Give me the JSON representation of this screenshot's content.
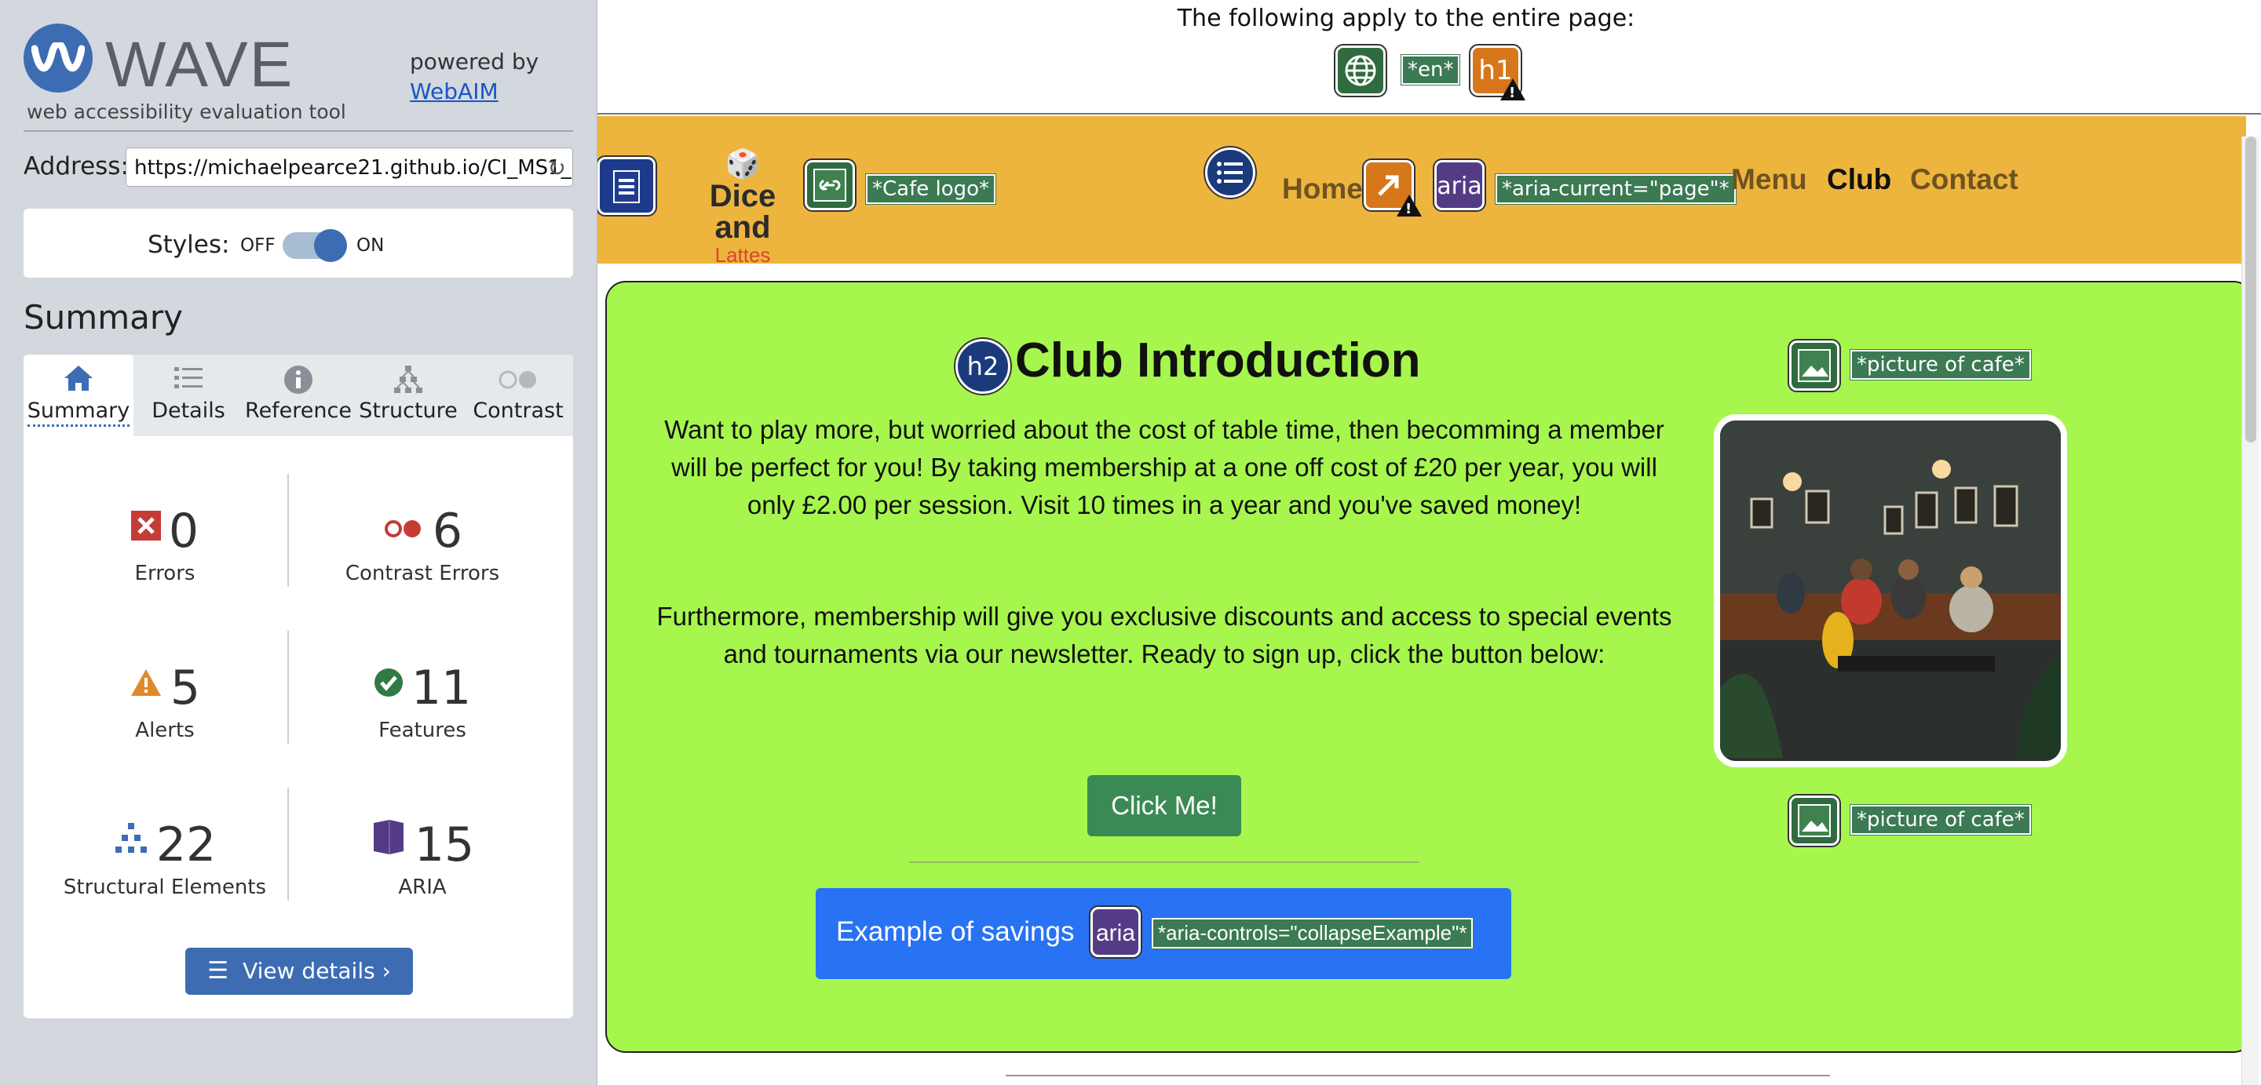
{
  "sidebar": {
    "logo_text": "WAVE",
    "tagline": "web accessibility evaluation tool",
    "powered_by": "powered by",
    "webaim_link": "WebAIM",
    "address_label": "Address:",
    "address_value": "https://michaelpearce21.github.io/CI_MS1_",
    "styles_label": "Styles:",
    "styles_off": "OFF",
    "styles_on": "ON",
    "summary_heading": "Summary",
    "tabs": [
      {
        "label": "Summary",
        "icon": "home-icon"
      },
      {
        "label": "Details",
        "icon": "list-icon"
      },
      {
        "label": "Reference",
        "icon": "info-icon"
      },
      {
        "label": "Structure",
        "icon": "hierarchy-icon"
      },
      {
        "label": "Contrast",
        "icon": "contrast-icon"
      }
    ],
    "stats": {
      "errors": {
        "value": "0",
        "label": "Errors"
      },
      "contrast": {
        "value": "6",
        "label": "Contrast Errors"
      },
      "alerts": {
        "value": "5",
        "label": "Alerts"
      },
      "features": {
        "value": "11",
        "label": "Features"
      },
      "structural": {
        "value": "22",
        "label": "Structural Elements"
      },
      "aria": {
        "value": "15",
        "label": "ARIA"
      }
    },
    "view_details": "View details ›"
  },
  "page": {
    "apply_text": "The following apply to the entire page:",
    "lang_label": "*en*",
    "h1_icon": "h1",
    "nav": {
      "home": "Home",
      "menu": "Menu",
      "club": "Club",
      "contact": "Contact",
      "aria_label": "*aria-current=\"page\"*",
      "aria_icon": "aria",
      "logo_alt_label": "*Cafe logo*",
      "brand_line1": "Dice and",
      "brand_line2": "Lattes"
    },
    "section": {
      "h2_icon": "h2",
      "title": "Club Introduction",
      "paragraph1": "Want to play more, but worried about the cost of table time, then becomming a member will be perfect for you! By taking membership at a one off cost of £20 per year, you will only £2.00 per session. Visit 10 times in a year and you've saved money!",
      "paragraph2": "Furthermore, membership will give you exclusive discounts and access to special events and tournaments via our newsletter. Ready to sign up, click the button below:",
      "click_button": "Click Me!",
      "savings_button": "Example of savings",
      "savings_aria_label": "*aria-controls=\"collapseExample\"*",
      "savings_aria_icon": "aria",
      "image_alt_label": "*picture of cafe*"
    }
  },
  "colors": {
    "wave_blue": "#3d6cb3",
    "navbar_bg": "#eeb53e",
    "card_bg": "#a6f64e",
    "button_green": "#3b8a55",
    "button_blue": "#2872f4",
    "label_green": "#3b7a52"
  }
}
